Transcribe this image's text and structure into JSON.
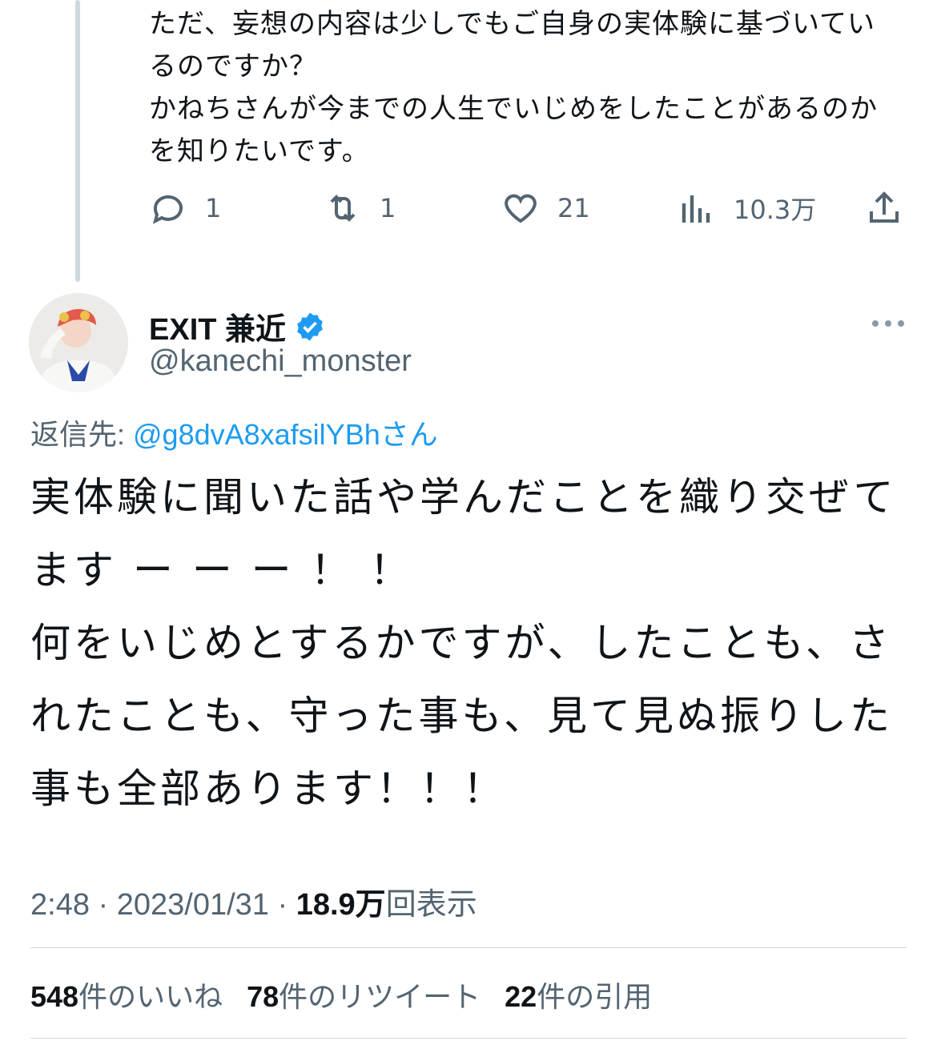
{
  "parent_tweet": {
    "text": "ただ、妄想の内容は少しでもご自身の実体験に基づいているのですか？\nかねちさんが今までの人生でいじめをしたことがあるのかを知りたいです。",
    "actions": {
      "reply_count": "1",
      "retweet_count": "1",
      "like_count": "21",
      "view_count": "10.3万"
    }
  },
  "tweet": {
    "author_name": "EXIT 兼近",
    "handle": "@kanechi_monster",
    "reply_prefix": "返信先: ",
    "reply_mention": "@g8dvA8xafsilYBh",
    "reply_suffix": "さん",
    "text": "実体験に聞いた話や学んだことを織り交ぜてます ー ー ー ！ ！\n何をいじめとするかですが、したことも、されたことも、守った事も、見て見ぬ振りした事も全部あります！！！",
    "time": "2:48",
    "date": "2023/01/31",
    "separator": "·",
    "views_number": "18.9万",
    "views_label": "回表示"
  },
  "stats": {
    "likes_number": "548",
    "likes_label": "件のいいね",
    "retweets_number": "78",
    "retweets_label": "件のリツイート",
    "quotes_number": "22",
    "quotes_label": "件の引用"
  },
  "colors": {
    "text": "#0f1419",
    "secondary": "#536471",
    "link": "#1d9bf0",
    "divider": "#cfd9de"
  }
}
